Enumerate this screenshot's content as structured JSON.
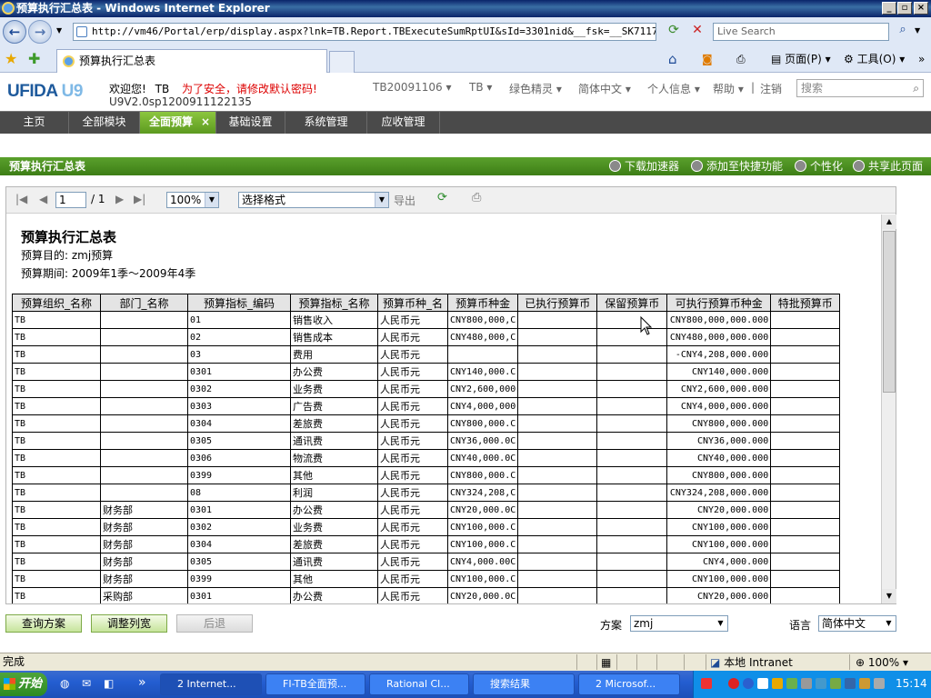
{
  "window": {
    "title": "预算执行汇总表 - Windows Internet Explorer",
    "address": "http://vm46/Portal/erp/display.aspx?lnk=TB.Report.TBExecuteSumRptUI&sId=3301nid&__fsk=__SK71170&__cur",
    "live_search_placeholder": "Live Search",
    "tab_title": "预算执行汇总表",
    "toolbar": {
      "page": "页面(P)",
      "tools": "工具(O)"
    }
  },
  "app": {
    "logo": "UFIDA",
    "logo_u9": "U9",
    "welcome": "欢迎您!",
    "user": "TB",
    "warning": "为了安全，请修改默认密码!",
    "version": "U9V2.0sp1200911122135",
    "nav": [
      "TB20091106 ▾",
      "TB ▾",
      "绿色精灵 ▾",
      "简体中文 ▾",
      "个人信息 ▾",
      "帮助 ▾",
      "|",
      "注销"
    ],
    "search_placeholder": "搜索"
  },
  "main_tabs": [
    "主页",
    "全部模块",
    "全面预算",
    "基础设置",
    "系统管理",
    "应收管理"
  ],
  "active_tab_index": 2,
  "page_bar": {
    "title": "预算执行汇总表",
    "actions": [
      "下载加速器",
      "添加至快捷功能",
      "个性化",
      "共享此页面"
    ]
  },
  "report_toolbar": {
    "page_current": "1",
    "page_total": "/ 1",
    "zoom": "100%",
    "format_select": "选择格式",
    "export": "导出"
  },
  "report": {
    "title": "预算执行汇总表",
    "purpose": "预算目的: zmj预算",
    "period": "预算期间: 2009年1季～2009年4季",
    "columns": [
      "预算组织_名称",
      "部门_名称",
      "预算指标_编码",
      "预算指标_名称",
      "预算币种_名",
      "预算币种金",
      "已执行预算币",
      "保留预算币",
      "可执行预算币种金",
      "特批预算币"
    ],
    "rows": [
      [
        "TB",
        "",
        "01",
        "销售收入",
        "人民币元",
        "CNY800,000,C",
        "",
        "",
        "CNY800,000,000.000",
        ""
      ],
      [
        "TB",
        "",
        "02",
        "销售成本",
        "人民币元",
        "CNY480,000,C",
        "",
        "",
        "CNY480,000,000.000",
        ""
      ],
      [
        "TB",
        "",
        "03",
        "费用",
        "人民币元",
        "",
        "",
        "",
        "-CNY4,208,000.000",
        ""
      ],
      [
        "TB",
        "",
        "0301",
        "办公费",
        "人民币元",
        "CNY140,000.C",
        "",
        "",
        "CNY140,000.000",
        ""
      ],
      [
        "TB",
        "",
        "0302",
        "业务费",
        "人民币元",
        "CNY2,600,000",
        "",
        "",
        "CNY2,600,000.000",
        ""
      ],
      [
        "TB",
        "",
        "0303",
        "广告费",
        "人民币元",
        "CNY4,000,000",
        "",
        "",
        "CNY4,000,000.000",
        ""
      ],
      [
        "TB",
        "",
        "0304",
        "差旅费",
        "人民币元",
        "CNY800,000.C",
        "",
        "",
        "CNY800,000.000",
        ""
      ],
      [
        "TB",
        "",
        "0305",
        "通讯费",
        "人民币元",
        "CNY36,000.0C",
        "",
        "",
        "CNY36,000.000",
        ""
      ],
      [
        "TB",
        "",
        "0306",
        "物流费",
        "人民币元",
        "CNY40,000.0C",
        "",
        "",
        "CNY40,000.000",
        ""
      ],
      [
        "TB",
        "",
        "0399",
        "其他",
        "人民币元",
        "CNY800,000.C",
        "",
        "",
        "CNY800,000.000",
        ""
      ],
      [
        "TB",
        "",
        "08",
        "利润",
        "人民币元",
        "CNY324,208,C",
        "",
        "",
        "CNY324,208,000.000",
        ""
      ],
      [
        "TB",
        "财务部",
        "0301",
        "办公费",
        "人民币元",
        "CNY20,000.0C",
        "",
        "",
        "CNY20,000.000",
        ""
      ],
      [
        "TB",
        "财务部",
        "0302",
        "业务费",
        "人民币元",
        "CNY100,000.C",
        "",
        "",
        "CNY100,000.000",
        ""
      ],
      [
        "TB",
        "财务部",
        "0304",
        "差旅费",
        "人民币元",
        "CNY100,000.C",
        "",
        "",
        "CNY100,000.000",
        ""
      ],
      [
        "TB",
        "财务部",
        "0305",
        "通讯费",
        "人民币元",
        "CNY4,000.00C",
        "",
        "",
        "CNY4,000.000",
        ""
      ],
      [
        "TB",
        "财务部",
        "0399",
        "其他",
        "人民币元",
        "CNY100,000.C",
        "",
        "",
        "CNY100,000.000",
        ""
      ],
      [
        "TB",
        "采购部",
        "0301",
        "办公费",
        "人民币元",
        "CNY20,000.0C",
        "",
        "",
        "CNY20,000.000",
        ""
      ]
    ]
  },
  "bottom": {
    "query_btn": "查询方案",
    "adjust_btn": "调整列宽",
    "back_btn": "后退",
    "scheme_label": "方案",
    "scheme_value": "zmj",
    "lang_label": "语言",
    "lang_value": "简体中文"
  },
  "status": {
    "text": "完成",
    "zone": "本地 Intranet",
    "zoom": "100%"
  },
  "taskbar": {
    "start": "开始",
    "tasks": [
      "2 Internet...",
      "FI-TB全面预...",
      "Rational Cl...",
      "搜索结果",
      "2 Microsof..."
    ],
    "clock": "15:14"
  }
}
